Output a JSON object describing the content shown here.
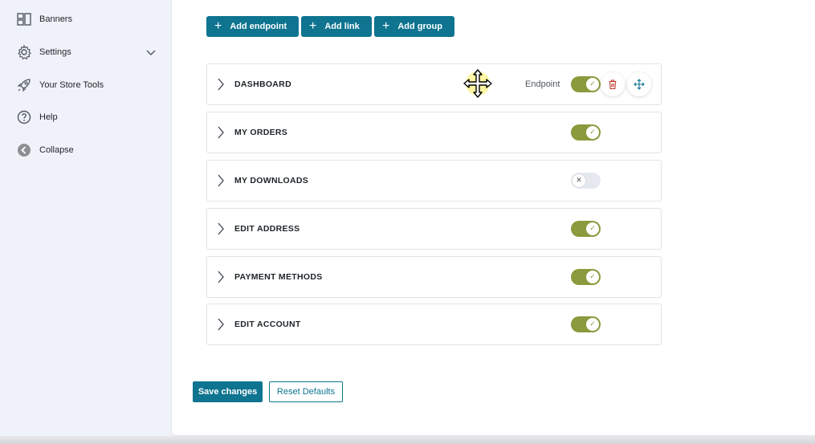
{
  "sidebar": {
    "items": [
      {
        "label": "Banners",
        "icon": "banners-icon"
      },
      {
        "label": "Settings",
        "icon": "gear-icon",
        "has_chevron": true
      },
      {
        "label": "Your Store Tools",
        "icon": "rocket-icon"
      },
      {
        "label": "Help",
        "icon": "help-icon"
      },
      {
        "label": "Collapse",
        "icon": "collapse-icon"
      }
    ]
  },
  "toolbar": {
    "add_endpoint": "Add endpoint",
    "add_link": "Add link",
    "add_group": "Add group"
  },
  "rows": [
    {
      "title": "DASHBOARD",
      "enabled": true,
      "type_label": "Endpoint",
      "hovered": true
    },
    {
      "title": "MY ORDERS",
      "enabled": true
    },
    {
      "title": "MY DOWNLOADS",
      "enabled": false
    },
    {
      "title": "EDIT ADDRESS",
      "enabled": true
    },
    {
      "title": "PAYMENT METHODS",
      "enabled": true
    },
    {
      "title": "EDIT ACCOUNT",
      "enabled": true
    }
  ],
  "footer": {
    "save_label": "Save changes",
    "reset_label": "Reset Defaults"
  },
  "colors": {
    "primary": "#0e7490",
    "toggle_on": "#8a9a3c",
    "delete": "#c0392b"
  }
}
